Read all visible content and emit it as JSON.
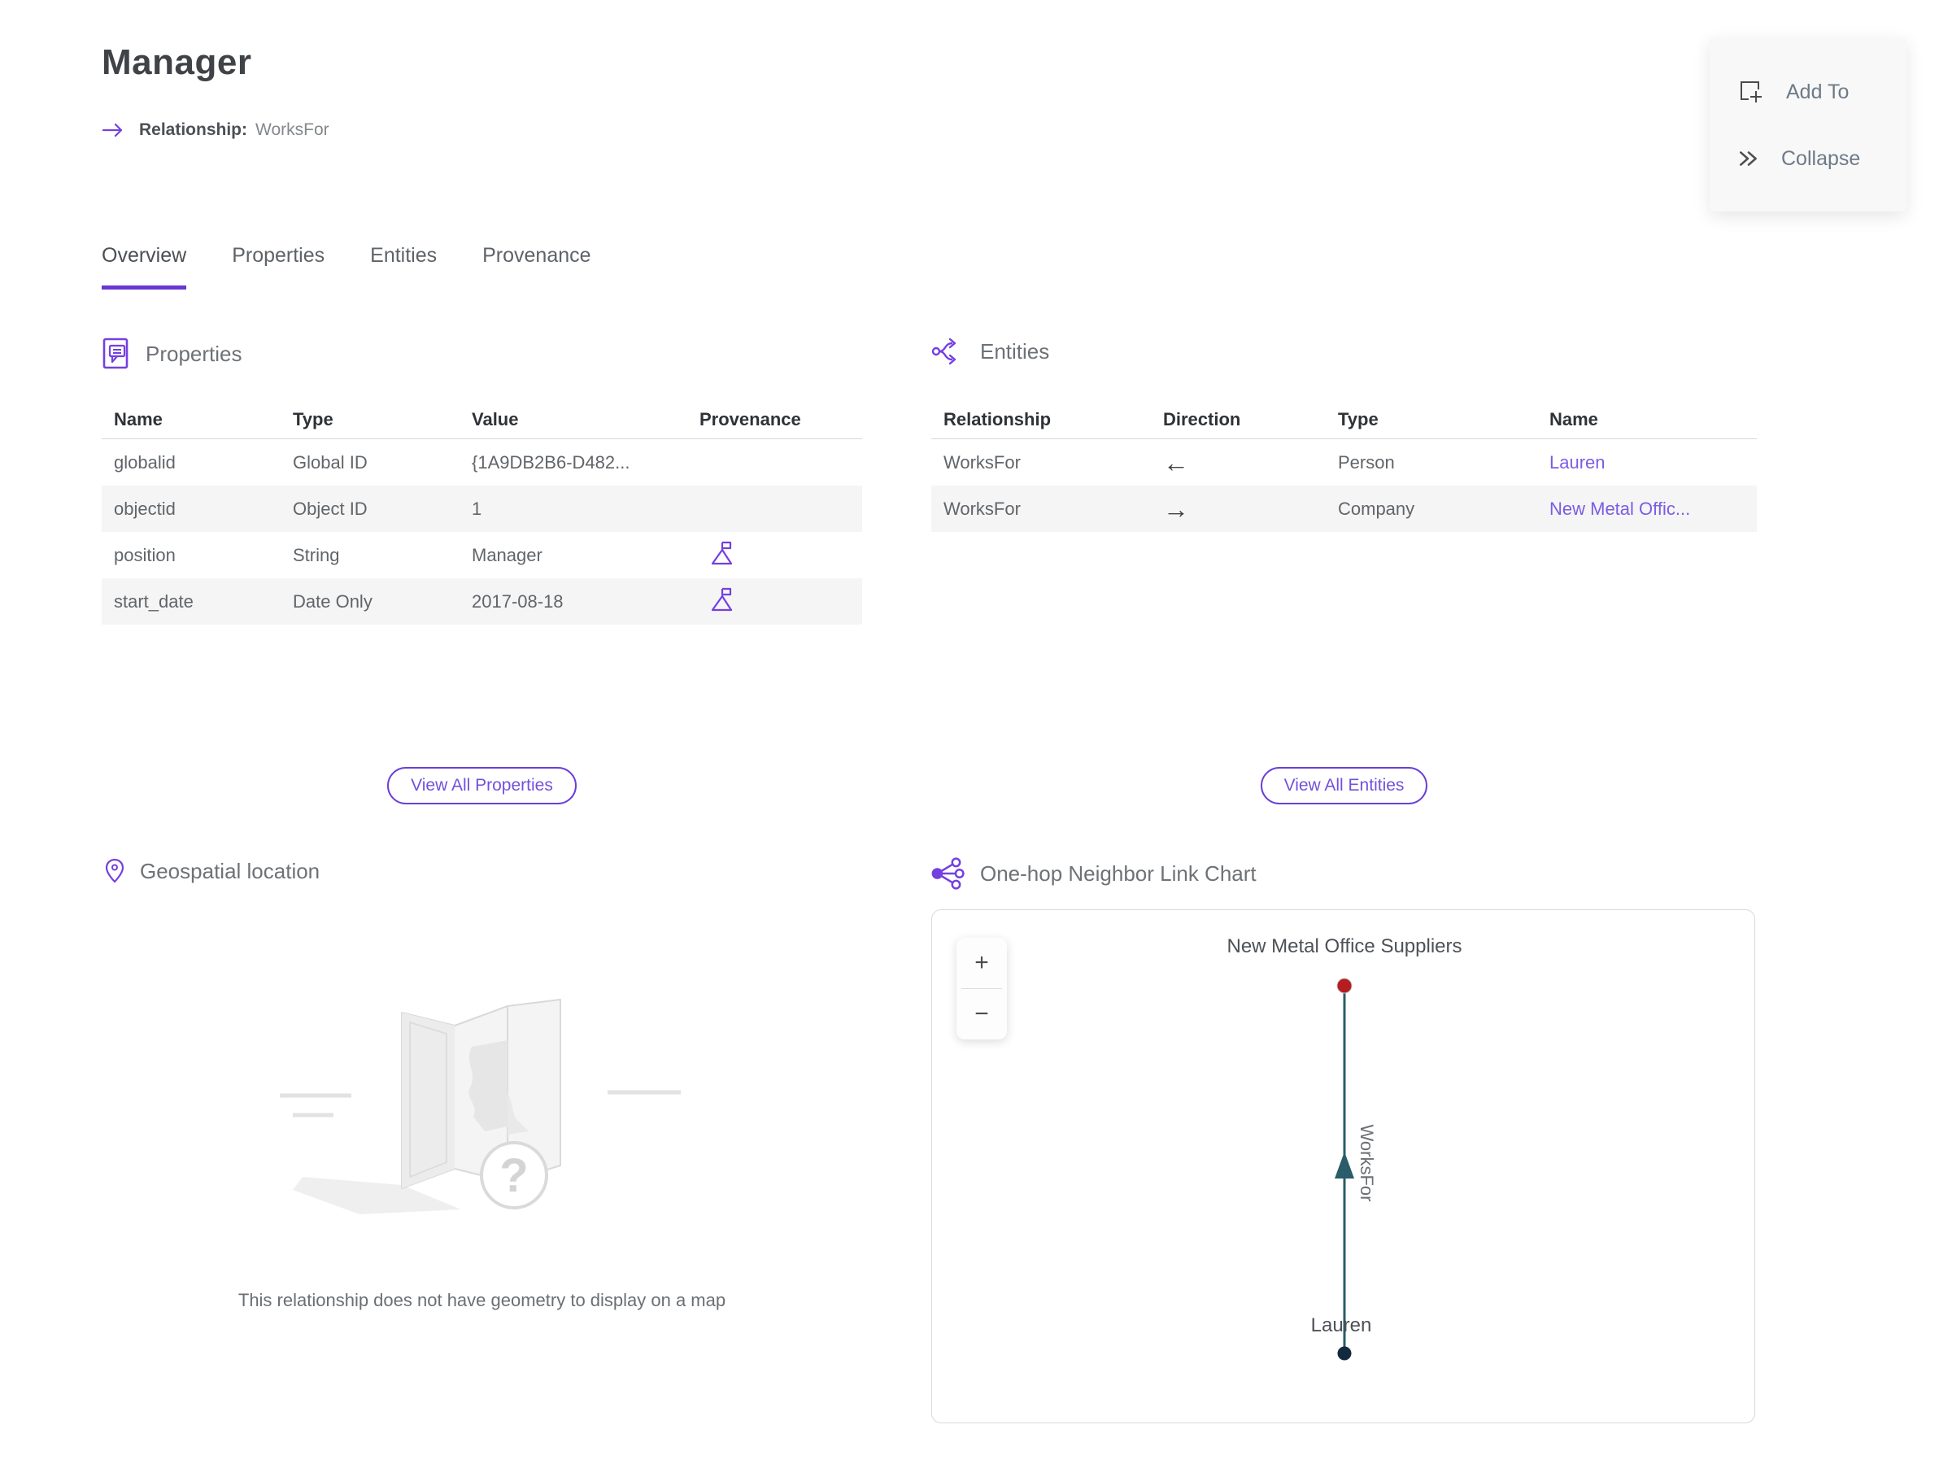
{
  "header": {
    "title": "Manager",
    "subtitle_label": "Relationship:",
    "subtitle_value": "WorksFor"
  },
  "actions": {
    "add_to": "Add To",
    "collapse": "Collapse"
  },
  "tabs": [
    {
      "label": "Overview",
      "active": true
    },
    {
      "label": "Properties",
      "active": false
    },
    {
      "label": "Entities",
      "active": false
    },
    {
      "label": "Provenance",
      "active": false
    }
  ],
  "properties_section": {
    "title": "Properties",
    "columns": [
      "Name",
      "Type",
      "Value",
      "Provenance"
    ],
    "rows": [
      {
        "name": "globalid",
        "type": "Global ID",
        "value": "{1A9DB2B6-D482...",
        "has_provenance": false
      },
      {
        "name": "objectid",
        "type": "Object ID",
        "value": "1",
        "has_provenance": false
      },
      {
        "name": "position",
        "type": "String",
        "value": "Manager",
        "has_provenance": true
      },
      {
        "name": "start_date",
        "type": "Date Only",
        "value": "2017-08-18",
        "has_provenance": true
      }
    ],
    "view_all_label": "View All Properties"
  },
  "entities_section": {
    "title": "Entities",
    "columns": [
      "Relationship",
      "Direction",
      "Type",
      "Name"
    ],
    "rows": [
      {
        "relationship": "WorksFor",
        "direction_glyph": "←",
        "type": "Person",
        "name": "Lauren"
      },
      {
        "relationship": "WorksFor",
        "direction_glyph": "→",
        "type": "Company",
        "name": "New Metal Offic..."
      }
    ],
    "view_all_label": "View All Entities"
  },
  "geospatial_section": {
    "title": "Geospatial location",
    "placeholder_glyph": "?",
    "empty_message": "This relationship does not have geometry to display on a map"
  },
  "link_chart_section": {
    "title": "One-hop Neighbor Link Chart",
    "zoom_in": "+",
    "zoom_out": "−",
    "chart_data": {
      "type": "node-link",
      "nodes": [
        {
          "label": "New Metal Office Suppliers",
          "color": "#b51d21",
          "position": "top"
        },
        {
          "label": "Lauren",
          "color": "#132a3e",
          "position": "bottom"
        }
      ],
      "edges": [
        {
          "label": "WorksFor",
          "from": "Lauren",
          "to": "New Metal Office Suppliers",
          "color": "#2a5c69",
          "arrow": "up"
        }
      ]
    }
  },
  "icons": {
    "relationship_arrow": "right-arrow",
    "add_to": "square-plus",
    "collapse": "double-chevron-right",
    "properties": "document-list",
    "entities": "fork-arrows",
    "geospatial": "map-pin",
    "one_hop": "share-network",
    "provenance": "flag-on-mountain"
  },
  "colors": {
    "accent_purple": "#6936d3",
    "icon_purple": "#7440e0",
    "link_purple": "#7b5ce4",
    "row_shade": "#f5f5f5",
    "edge_teal": "#2a5c69",
    "node_red": "#b51d21",
    "node_dark": "#132a3e"
  }
}
